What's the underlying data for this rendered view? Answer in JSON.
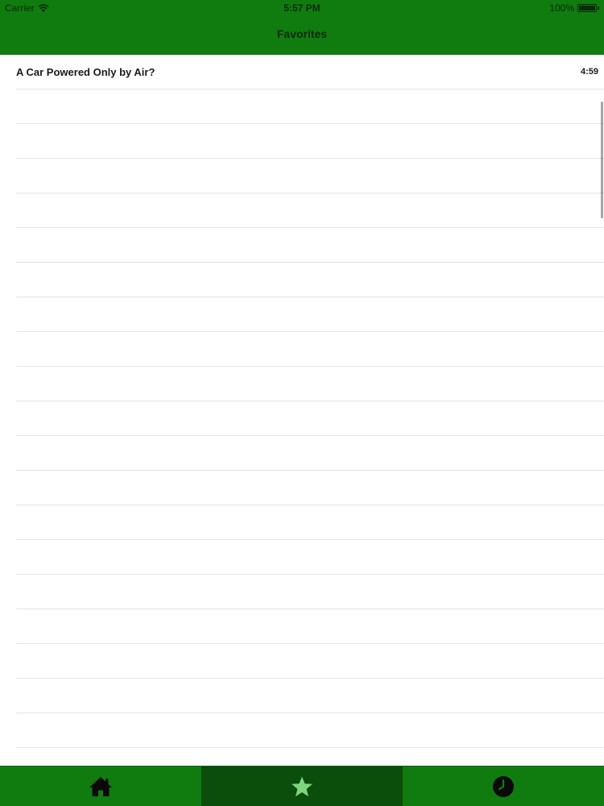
{
  "status_bar": {
    "carrier": "Carrier",
    "time": "5:57 PM",
    "battery": "100%"
  },
  "nav": {
    "title": "Favorites"
  },
  "favorites": [
    {
      "title": "A Car Powered Only by Air?",
      "duration": "4:59"
    }
  ],
  "tabbar": {
    "tabs": [
      {
        "icon": "home-icon",
        "selected": false
      },
      {
        "icon": "star-icon",
        "selected": true
      },
      {
        "icon": "clock-icon",
        "selected": false
      }
    ]
  },
  "colors": {
    "brand_green": "#107C10",
    "selected_tab": "#0b4d0b",
    "star_active": "#7ed67e",
    "icon_dark": "#0a0a0a"
  }
}
